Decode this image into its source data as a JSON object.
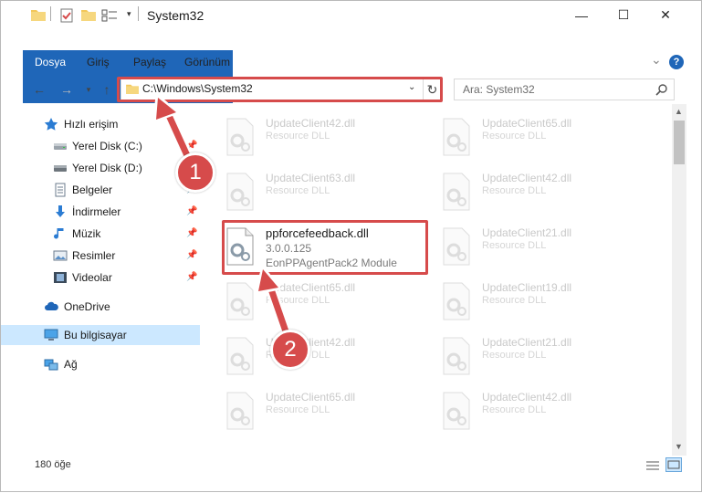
{
  "window": {
    "title": "System32",
    "minimize_glyph": "—",
    "maximize_glyph": "☐",
    "close_glyph": "✕"
  },
  "ribbon": {
    "tabs": [
      {
        "label": "Dosya"
      },
      {
        "label": "Giriş"
      },
      {
        "label": "Paylaş"
      },
      {
        "label": "Görünüm"
      }
    ],
    "collapse_glyph": "⌄",
    "help_glyph": "?"
  },
  "nav": {
    "address": "C:\\Windows\\System32",
    "search_placeholder": "Ara: System32"
  },
  "sidebar": {
    "quick_access": "Hızlı erişim",
    "items": [
      {
        "label": "Yerel Disk (C:)",
        "pinned": true
      },
      {
        "label": "Yerel Disk (D:)",
        "pinned": false
      },
      {
        "label": "Belgeler",
        "pinned": true
      },
      {
        "label": "İndirmeler",
        "pinned": true
      },
      {
        "label": "Müzik",
        "pinned": true
      },
      {
        "label": "Resimler",
        "pinned": true
      },
      {
        "label": "Videolar",
        "pinned": true
      }
    ],
    "onedrive": "OneDrive",
    "this_pc": "Bu bilgisayar",
    "network": "Ağ",
    "pin_glyph": "📌"
  },
  "files": {
    "left": [
      {
        "name": "UpdateClient42.dll",
        "desc": "Resource DLL"
      },
      {
        "name": "UpdateClient63.dll",
        "desc": "Resource DLL"
      },
      {
        "name": "ppforcefeedback.dll",
        "desc": "3.0.0.125",
        "desc2": "EonPPAgentPack2 Module"
      },
      {
        "name": "UpdateClient65.dll",
        "desc": "Resource DLL"
      },
      {
        "name": "UpdateClient42.dll",
        "desc": "Resource DLL"
      },
      {
        "name": "UpdateClient65.dll",
        "desc": "Resource DLL"
      }
    ],
    "right": [
      {
        "name": "UpdateClient65.dll",
        "desc": "Resource DLL"
      },
      {
        "name": "UpdateClient42.dll",
        "desc": "Resource DLL"
      },
      {
        "name": "UpdateClient21.dll",
        "desc": "Resource DLL"
      },
      {
        "name": "UpdateClient19.dll",
        "desc": "Resource DLL"
      },
      {
        "name": "UpdateClient21.dll",
        "desc": "Resource DLL"
      },
      {
        "name": "UpdateClient42.dll",
        "desc": "Resource DLL"
      }
    ]
  },
  "status": {
    "count": "180 öğe"
  },
  "callouts": [
    "1",
    "2"
  ],
  "colors": {
    "accent": "#1f66b8",
    "highlight": "#d64b4b",
    "selected": "#cce8ff"
  }
}
